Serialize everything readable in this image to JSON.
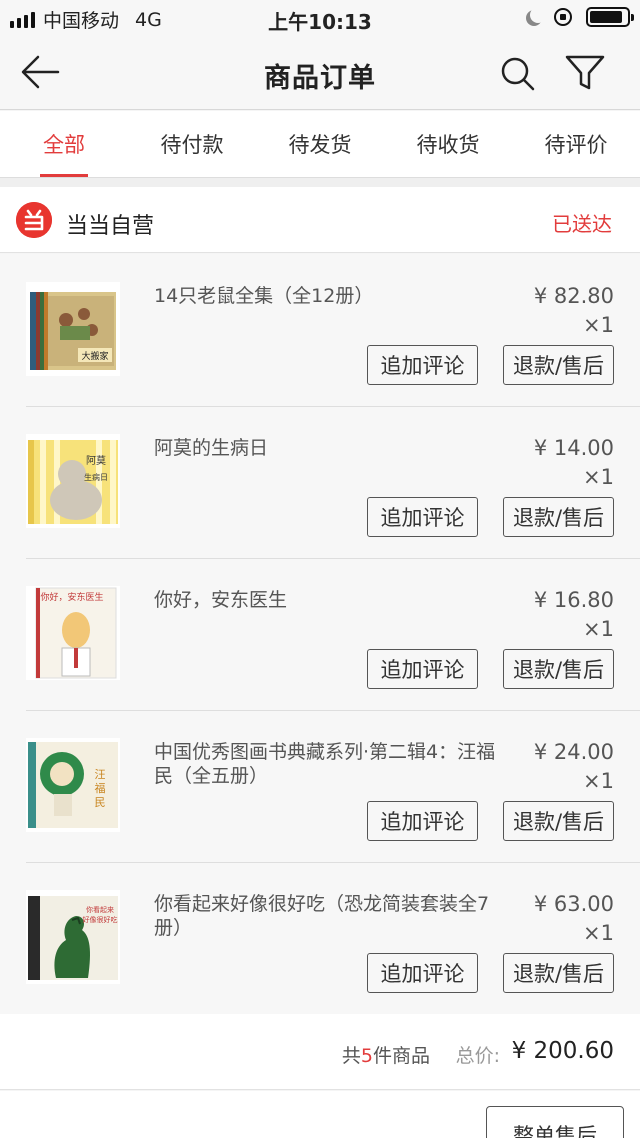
{
  "status_bar": {
    "carrier": "中国移动",
    "network": "4G",
    "time": "上午10:13",
    "battery_level": 0.9
  },
  "nav": {
    "title": "商品订单",
    "back_icon": "arrow-left-icon",
    "search_icon": "search-icon",
    "filter_icon": "filter-icon"
  },
  "tabs": [
    {
      "label": "全部",
      "active": true
    },
    {
      "label": "待付款",
      "active": false
    },
    {
      "label": "待发货",
      "active": false
    },
    {
      "label": "待收货",
      "active": false
    },
    {
      "label": "待评价",
      "active": false
    }
  ],
  "shop": {
    "logo_char": "当",
    "name": "当当自营",
    "status": "已送达"
  },
  "items": [
    {
      "title": "14只老鼠全集（全12册）",
      "price": "¥ 82.80",
      "qty": "×1",
      "review_label": "追加评论",
      "refund_label": "退款/售后"
    },
    {
      "title": "阿莫的生病日",
      "price": "¥ 14.00",
      "qty": "×1",
      "review_label": "追加评论",
      "refund_label": "退款/售后"
    },
    {
      "title": "你好，安东医生",
      "price": "¥ 16.80",
      "qty": "×1",
      "review_label": "追加评论",
      "refund_label": "退款/售后"
    },
    {
      "title": "中国优秀图画书典藏系列·第二辑4：汪福民（全五册）",
      "price": "¥ 24.00",
      "qty": "×1",
      "review_label": "追加评论",
      "refund_label": "退款/售后"
    },
    {
      "title": "你看起来好像很好吃（恐龙简装套装全7册）",
      "price": "¥ 63.00",
      "qty": "×1",
      "review_label": "追加评论",
      "refund_label": "退款/售后"
    }
  ],
  "summary": {
    "count_prefix": "共",
    "count": "5",
    "count_suffix": "件商品",
    "total_label": "总价:",
    "total": "¥ 200.60"
  },
  "footer": {
    "after_sale_label": "整单售后"
  },
  "colors": {
    "accent": "#e23c3c",
    "shop_logo": "#e8352f"
  }
}
